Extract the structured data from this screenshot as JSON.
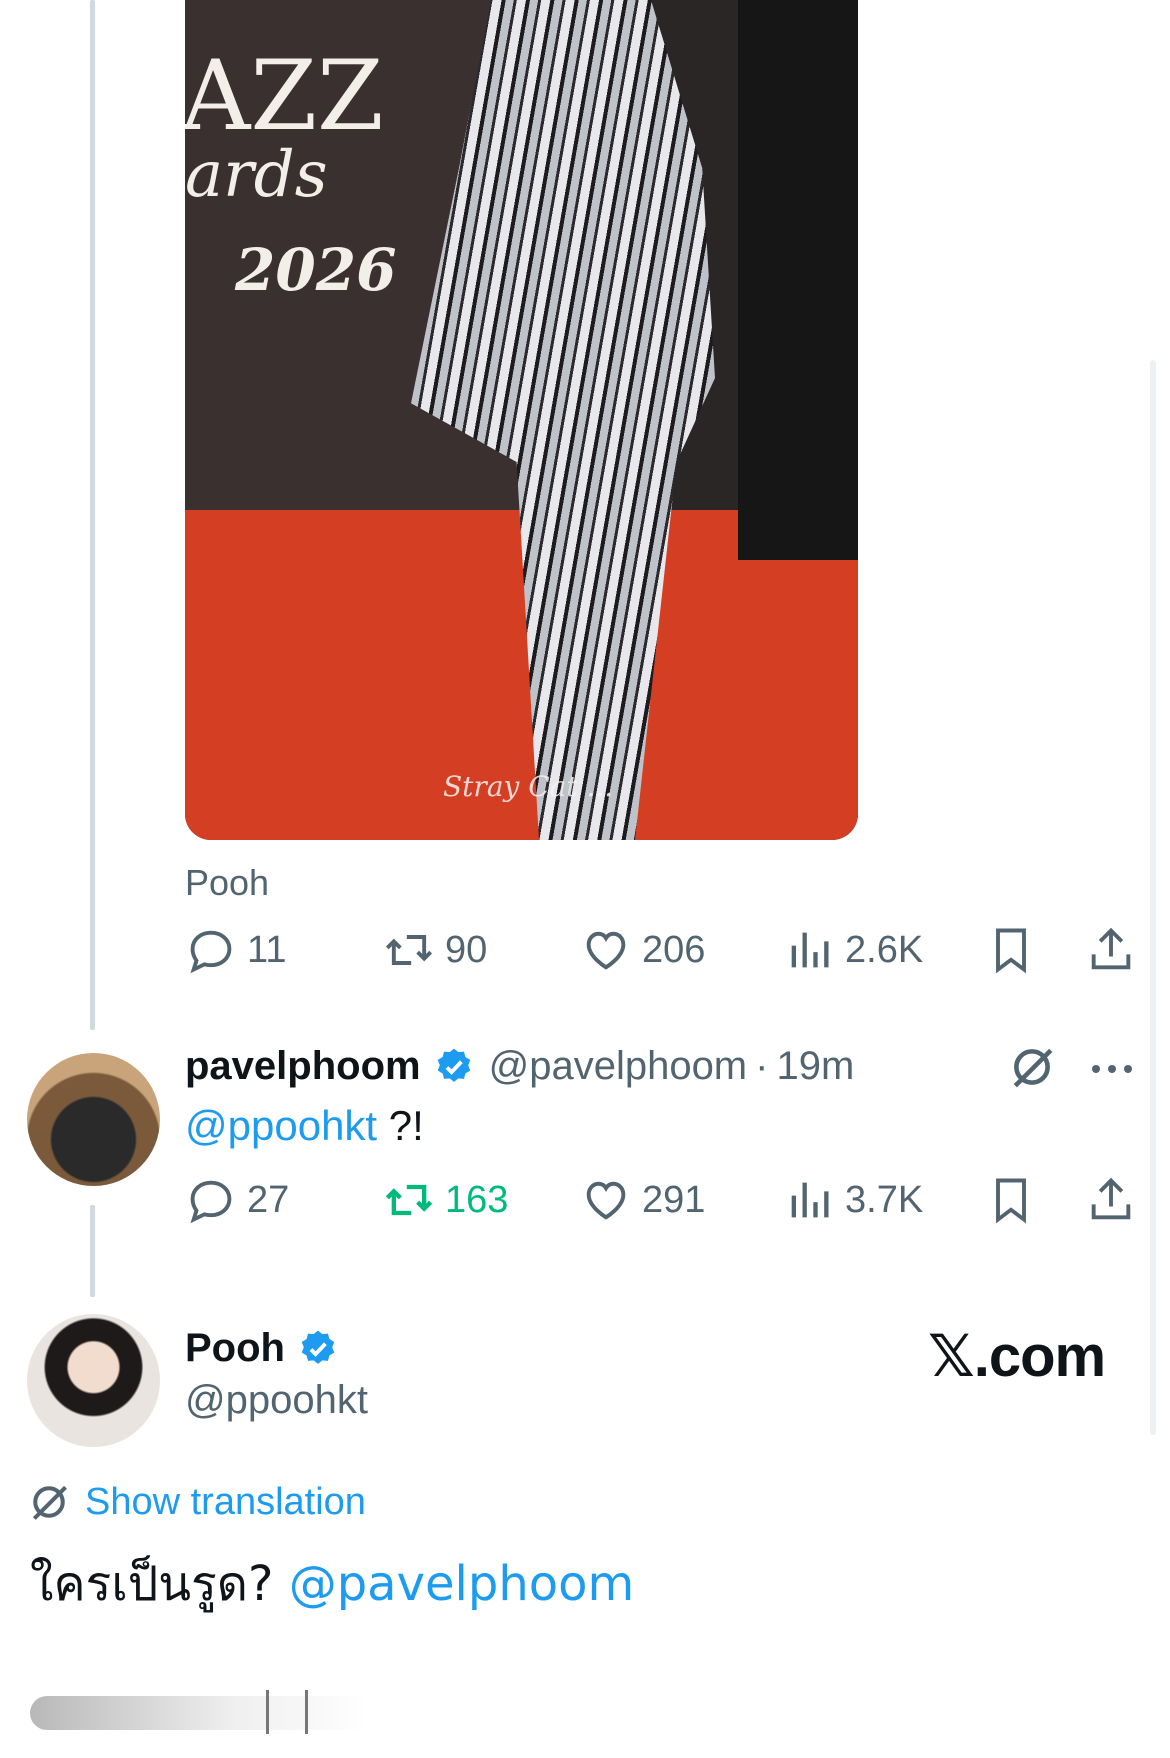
{
  "top_post": {
    "media": {
      "board_text_1": "AZZ",
      "board_text_2": "ards",
      "board_text_3": "2026",
      "watermark": "Stray Cat ..."
    },
    "author_label": "Pooh",
    "actions": {
      "replies": "11",
      "reposts": "90",
      "likes": "206",
      "views": "2.6K"
    }
  },
  "reply": {
    "display_name": "pavelphoom",
    "handle": "@pavelphoom",
    "separator": "·",
    "time": "19m",
    "text_mention": "@ppoohkt",
    "text_rest": " ?!",
    "actions": {
      "replies": "27",
      "reposts": "163",
      "likes": "291",
      "views": "3.7K"
    }
  },
  "main_post": {
    "display_name": "Pooh",
    "handle": "@ppoohkt",
    "site_label": "𝕏.com",
    "show_translation": "Show translation",
    "text_thai": "ใครเป็นรูด? ",
    "text_mention": "@pavelphoom"
  },
  "colors": {
    "accent": "#1d9bf0",
    "repost_active": "#00ba7c",
    "secondary_text": "#536471"
  },
  "icons": [
    "reply-icon",
    "repost-icon",
    "like-icon",
    "views-icon",
    "bookmark-icon",
    "share-icon",
    "verified-badge-icon",
    "translate-icon",
    "more-icon"
  ]
}
